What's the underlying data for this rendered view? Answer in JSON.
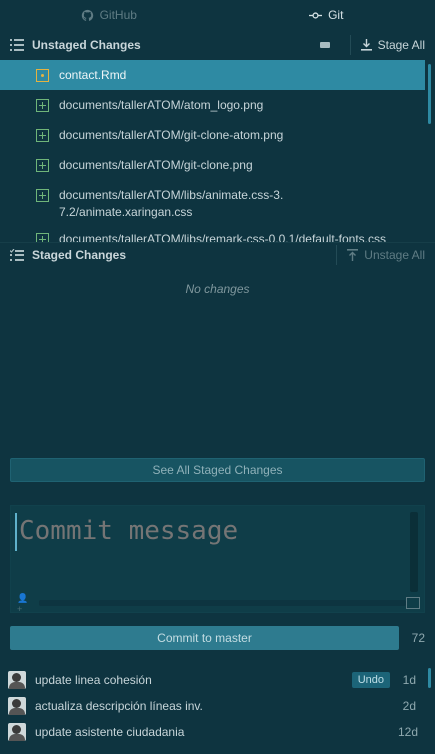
{
  "tabs": [
    {
      "label": "GitHub",
      "icon": "github-icon",
      "active": false
    },
    {
      "label": "Git",
      "icon": "git-commit-icon",
      "active": true
    }
  ],
  "unstaged": {
    "title": "Unstaged Changes",
    "stage_all_label": "Stage All",
    "files": [
      {
        "name": "contact.Rmd",
        "status": "modified",
        "selected": true
      },
      {
        "name": "documents/tallerATOM/atom_logo.png",
        "status": "added"
      },
      {
        "name": "documents/tallerATOM/git-clone-atom.png",
        "status": "added"
      },
      {
        "name": "documents/tallerATOM/git-clone.png",
        "status": "added"
      },
      {
        "name": "documents/tallerATOM/libs/animate.css-3.7.2/animate.xaringan.css",
        "status": "added"
      },
      {
        "name": "documents/tallerATOM/libs/remark-css-0.0.1/default-fonts.css",
        "status": "added"
      }
    ]
  },
  "staged": {
    "title": "Staged Changes",
    "unstage_all_label": "Unstage All",
    "empty_text": "No changes",
    "see_all_label": "See All Staged Changes"
  },
  "commit": {
    "placeholder": "Commit message",
    "button_label": "Commit to master",
    "remaining_chars": "72"
  },
  "recent_commits": [
    {
      "message": "update linea cohesión",
      "age": "1d",
      "undo_label": "Undo"
    },
    {
      "message": "actualiza descripción líneas inv.",
      "age": "2d"
    },
    {
      "message": "update asistente ciudadania",
      "age": "12d"
    }
  ],
  "colors": {
    "background": "#0e3440",
    "selection": "#2e8aa3",
    "added": "#6fb57a",
    "modified": "#e3b341"
  }
}
